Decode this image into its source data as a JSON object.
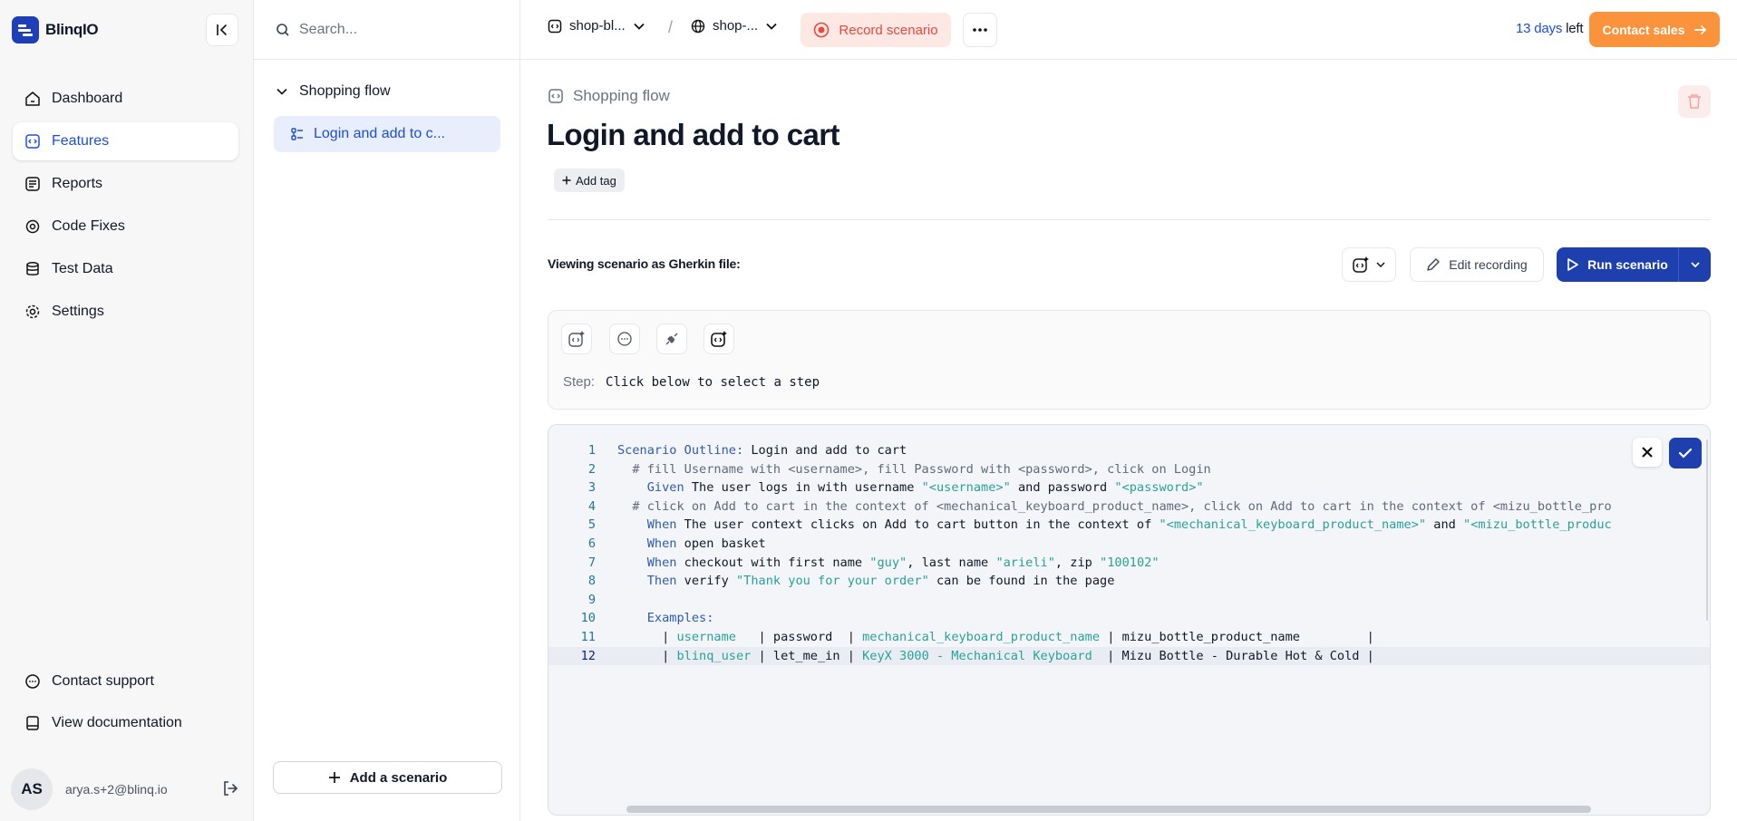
{
  "app": {
    "brand_name": "BlinqIO",
    "brand_color": "#1e3fb8"
  },
  "nav": {
    "items": [
      {
        "label": "Dashboard",
        "icon": "home-icon"
      },
      {
        "label": "Features",
        "icon": "features-icon",
        "active": true
      },
      {
        "label": "Reports",
        "icon": "reports-icon"
      },
      {
        "label": "Code Fixes",
        "icon": "code-fixes-icon"
      },
      {
        "label": "Test Data",
        "icon": "database-icon"
      },
      {
        "label": "Settings",
        "icon": "gear-icon"
      }
    ],
    "footer": [
      {
        "label": "Contact support",
        "icon": "chat-icon"
      },
      {
        "label": "View documentation",
        "icon": "book-icon"
      }
    ],
    "user": {
      "initials": "AS",
      "email": "arya.s+2@blinq.io"
    }
  },
  "features_panel": {
    "search_placeholder": "Search...",
    "folder": "Shopping flow",
    "scenario": "Login and add to c...",
    "add_scenario": "Add a scenario"
  },
  "topbar": {
    "project": "shop-bl...",
    "environment": "shop-...",
    "record_label": "Record scenario",
    "trial_days": "13 days",
    "trial_suffix": "left",
    "contact_sales": "Contact sales"
  },
  "main": {
    "feature_name": "Shopping flow",
    "title": "Login and add to cart",
    "add_tag": "Add tag",
    "view_label": "Viewing scenario as Gherkin file:",
    "edit_recording": "Edit recording",
    "run_scenario": "Run scenario",
    "step_label": "Step:",
    "step_text": "Click below to select a step"
  },
  "editor": {
    "current_line": 12,
    "lines": [
      [
        {
          "t": "Scenario Outline:",
          "c": "kw"
        },
        {
          "t": " Login and add to cart"
        }
      ],
      [
        {
          "t": "  # fill Username with <username>, fill Password with <password>, click on Login",
          "c": "cm"
        }
      ],
      [
        {
          "t": "    "
        },
        {
          "t": "Given",
          "c": "kw"
        },
        {
          "t": " The user logs in with username "
        },
        {
          "t": "\"<username>\"",
          "c": "st"
        },
        {
          "t": " and password "
        },
        {
          "t": "\"<password>\"",
          "c": "st"
        }
      ],
      [
        {
          "t": "  # click on Add to cart in the context of <mechanical_keyboard_product_name>, click on Add to cart in the context of <mizu_bottle_pro",
          "c": "cm"
        }
      ],
      [
        {
          "t": "    "
        },
        {
          "t": "When",
          "c": "kw"
        },
        {
          "t": " The user context clicks on Add to cart button in the context of "
        },
        {
          "t": "\"<mechanical_keyboard_product_name>\"",
          "c": "st"
        },
        {
          "t": " and "
        },
        {
          "t": "\"<mizu_bottle_produc",
          "c": "st"
        }
      ],
      [
        {
          "t": "    "
        },
        {
          "t": "When",
          "c": "kw"
        },
        {
          "t": " open basket"
        }
      ],
      [
        {
          "t": "    "
        },
        {
          "t": "When",
          "c": "kw"
        },
        {
          "t": " checkout with first name "
        },
        {
          "t": "\"guy\"",
          "c": "st"
        },
        {
          "t": ", last name "
        },
        {
          "t": "\"arieli\"",
          "c": "st"
        },
        {
          "t": ", zip "
        },
        {
          "t": "\"100102\"",
          "c": "st"
        }
      ],
      [
        {
          "t": "    "
        },
        {
          "t": "Then",
          "c": "kw"
        },
        {
          "t": " verify "
        },
        {
          "t": "\"Thank you for your order\"",
          "c": "st"
        },
        {
          "t": " can be found in the page"
        }
      ],
      [
        {
          "t": ""
        }
      ],
      [
        {
          "t": "    "
        },
        {
          "t": "Examples:",
          "c": "kw"
        }
      ],
      [
        {
          "t": "      | "
        },
        {
          "t": "username",
          "c": "tb"
        },
        {
          "t": "   | password  | "
        },
        {
          "t": "mechanical_keyboard_product_name",
          "c": "tb"
        },
        {
          "t": " | mizu_bottle_product_name         |"
        }
      ],
      [
        {
          "t": "      | "
        },
        {
          "t": "blinq_user",
          "c": "tb"
        },
        {
          "t": " | let_me_in | "
        },
        {
          "t": "KeyX 3000 - Mechanical Keyboard",
          "c": "tb"
        },
        {
          "t": "  | Mizu Bottle - Durable Hot & Cold |"
        }
      ]
    ]
  },
  "colors": {
    "accent": "#1e40af",
    "record": "#e8493a",
    "contact_sales": "#fb923c"
  }
}
